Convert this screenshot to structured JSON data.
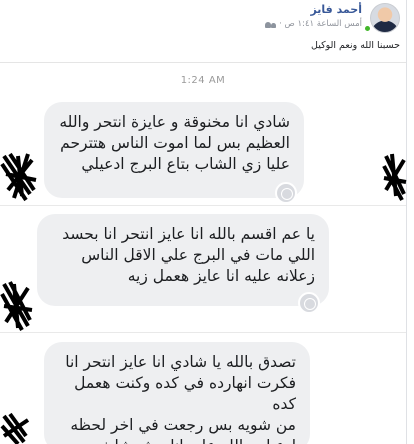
{
  "post": {
    "author": "أحمد فايز",
    "meta_time": "أمس الساعة ١:٤١ ص ·",
    "text": "حسبنا الله ونعم الوكيل"
  },
  "conversation": {
    "timestamp": "1:24 AM",
    "messages": [
      {
        "lines": [
          "شادي انا مخنوقة و عايزة انتحر والله",
          "العظيم بس لما اموت الناس هتترحم",
          "عليا زي الشاب بتاع البرج ادعيلي"
        ]
      },
      {
        "lines": [
          "يا عم اقسم بالله انا عايز انتحر انا بحسد",
          "اللي مات في البرج علي الاقل الناس",
          "زعلانه عليه انا عايز هعمل زيه"
        ]
      },
      {
        "lines": [
          "تصدق بالله يا شادي انا عايز انتحر انا",
          "فكرت انهارده في كده وكنت هعمل كده",
          "من شويه بس رجعت في اخر لحظه",
          "ادعيلي بالله علي انا مش شايف"
        ]
      }
    ]
  },
  "icons": {
    "privacy": "friends-icon",
    "reaction": "add-reaction-icon",
    "online": "online-dot"
  },
  "colors": {
    "author_link": "#385898",
    "bubble_bg": "#eeeff1",
    "online": "#42b72a"
  }
}
